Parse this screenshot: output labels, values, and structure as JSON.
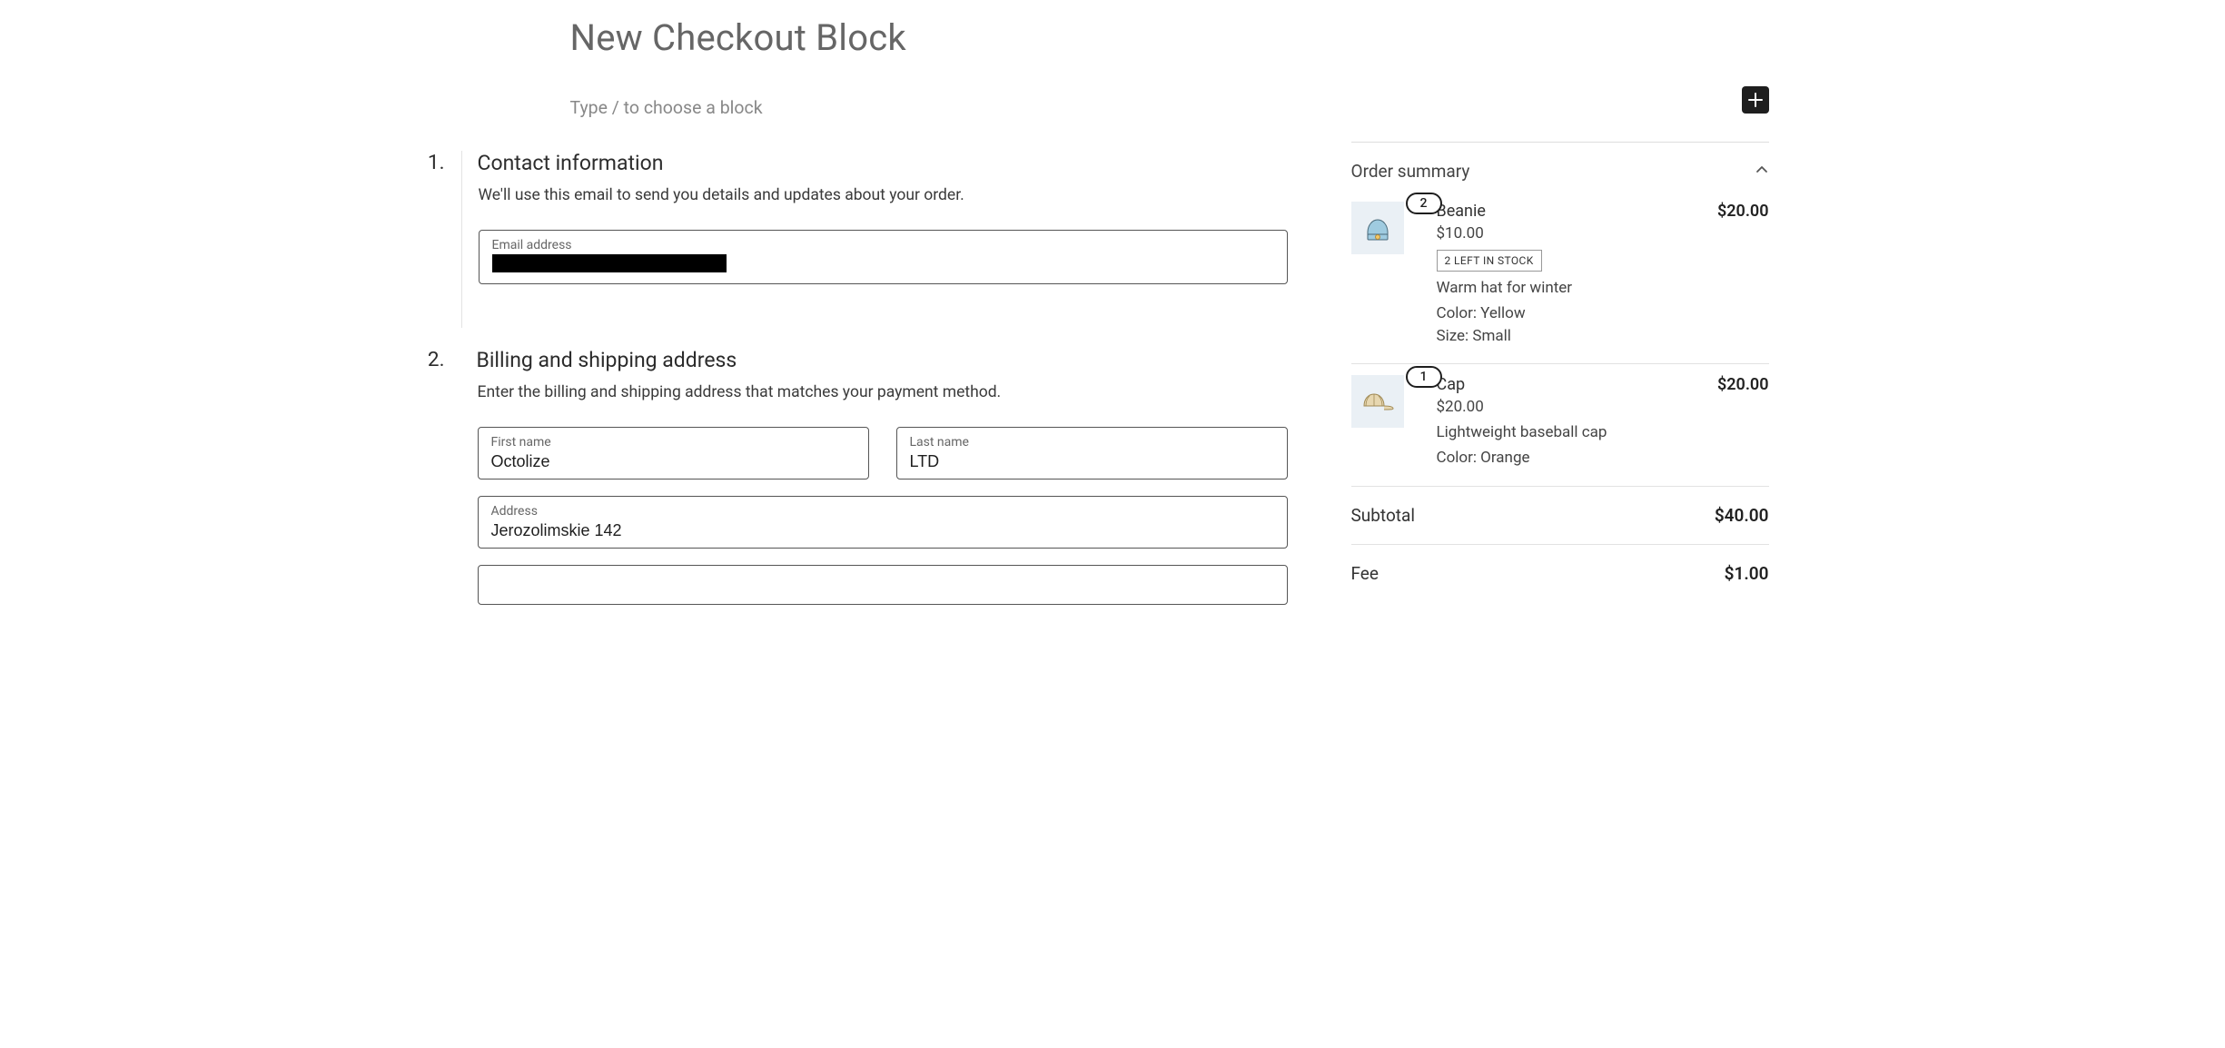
{
  "page": {
    "title": "New Checkout Block",
    "block_prompt": "Type / to choose a block"
  },
  "steps": {
    "contact": {
      "number": "1.",
      "title": "Contact information",
      "description": "We'll use this email to send you details and updates about your order.",
      "email_label": "Email address"
    },
    "billing": {
      "number": "2.",
      "title": "Billing and shipping address",
      "description": "Enter the billing and shipping address that matches your payment method.",
      "first_name_label": "First name",
      "first_name_value": "Octolize",
      "last_name_label": "Last name",
      "last_name_value": "LTD",
      "address_label": "Address",
      "address_value": "Jerozolimskie 142"
    }
  },
  "summary": {
    "title": "Order summary",
    "items": [
      {
        "qty": "2",
        "name": "Beanie",
        "line_total": "$20.00",
        "unit_price": "$10.00",
        "stock_badge": "2 LEFT IN STOCK",
        "description": "Warm hat for winter",
        "attrs": [
          "Color: Yellow",
          "Size: Small"
        ],
        "thumb_color": "#9fcbe0"
      },
      {
        "qty": "1",
        "name": "Cap",
        "line_total": "$20.00",
        "unit_price": "$20.00",
        "description": "Lightweight baseball cap",
        "attrs": [
          "Color: Orange"
        ],
        "thumb_color": "#e7d7b0"
      }
    ],
    "subtotal_label": "Subtotal",
    "subtotal_value": "$40.00",
    "fee_label": "Fee",
    "fee_value": "$1.00"
  }
}
